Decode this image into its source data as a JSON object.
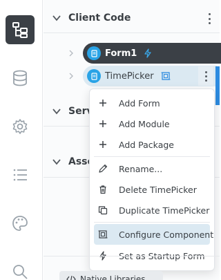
{
  "rail": {
    "items": [
      {
        "icon": "tree-icon",
        "active": true
      },
      {
        "icon": "database-icon",
        "active": false
      },
      {
        "icon": "gear-icon",
        "active": false
      },
      {
        "icon": "list-icon",
        "active": false
      },
      {
        "icon": "palette-icon",
        "active": false
      },
      {
        "icon": "search-icon",
        "active": false
      }
    ]
  },
  "sections": {
    "client_code": "Client Code",
    "server": "Serv",
    "assets": "Asse"
  },
  "tree": {
    "form_label": "Form1",
    "timepicker_label": "TimePicker"
  },
  "menu": {
    "items": [
      {
        "label": "Add Form",
        "icon": "plus-icon"
      },
      {
        "label": "Add Module",
        "icon": "plus-icon"
      },
      {
        "label": "Add Package",
        "icon": "plus-icon"
      },
      {
        "label": "Rename...",
        "icon": "pencil-icon"
      },
      {
        "label": "Delete TimePicker",
        "icon": "trash-icon"
      },
      {
        "label": "Duplicate TimePicker",
        "icon": "copy-icon"
      },
      {
        "label": "Configure Component",
        "icon": "component-icon",
        "highlighted": true
      },
      {
        "label": "Set as Startup Form",
        "icon": "lightning-icon"
      }
    ]
  },
  "bottom": {
    "native_libraries": "Native Libraries"
  },
  "colors": {
    "accent": "#29a3e6",
    "dark": "#3b4046",
    "highlight": "#dbe9f2",
    "edge": "#2d8be0"
  }
}
